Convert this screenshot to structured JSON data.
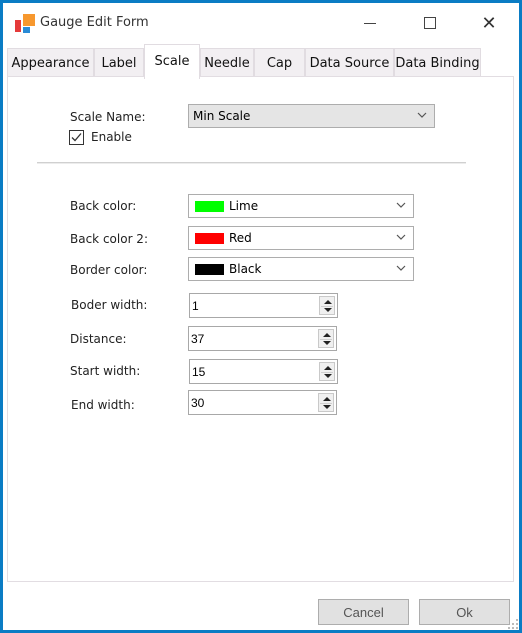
{
  "window": {
    "title": "Gauge Edit Form",
    "controls": {
      "minimize": "minimize-icon",
      "maximize": "maximize-icon",
      "close": "close-icon"
    }
  },
  "tabs": [
    {
      "label": "Appearance",
      "active": false
    },
    {
      "label": "Label",
      "active": false
    },
    {
      "label": "Scale",
      "active": true
    },
    {
      "label": "Needle",
      "active": false
    },
    {
      "label": "Cap",
      "active": false
    },
    {
      "label": "Data Source",
      "active": false
    },
    {
      "label": "Data Binding",
      "active": false
    }
  ],
  "scale": {
    "name_label": "Scale Name:",
    "name_value": "Min Scale",
    "enable_label": "Enable",
    "enable_checked": true
  },
  "colors": {
    "back_color": {
      "label": "Back color:",
      "value": "Lime",
      "swatch": "#00ff00"
    },
    "back_color_2": {
      "label": "Back color 2:",
      "value": "Red",
      "swatch": "#ff0000"
    },
    "border_color": {
      "label": "Border color:",
      "value": "Black",
      "swatch": "#000000"
    }
  },
  "numbers": {
    "border_width": {
      "label": "Boder width:",
      "value": "1"
    },
    "distance": {
      "label": "Distance:",
      "value": "37"
    },
    "start_width": {
      "label": "Start width:",
      "value": "15"
    },
    "end_width": {
      "label": "End width:",
      "value": "30"
    }
  },
  "buttons": {
    "cancel": "Cancel",
    "ok": "Ok"
  },
  "theme": {
    "window_border": "#0a7cc4"
  }
}
